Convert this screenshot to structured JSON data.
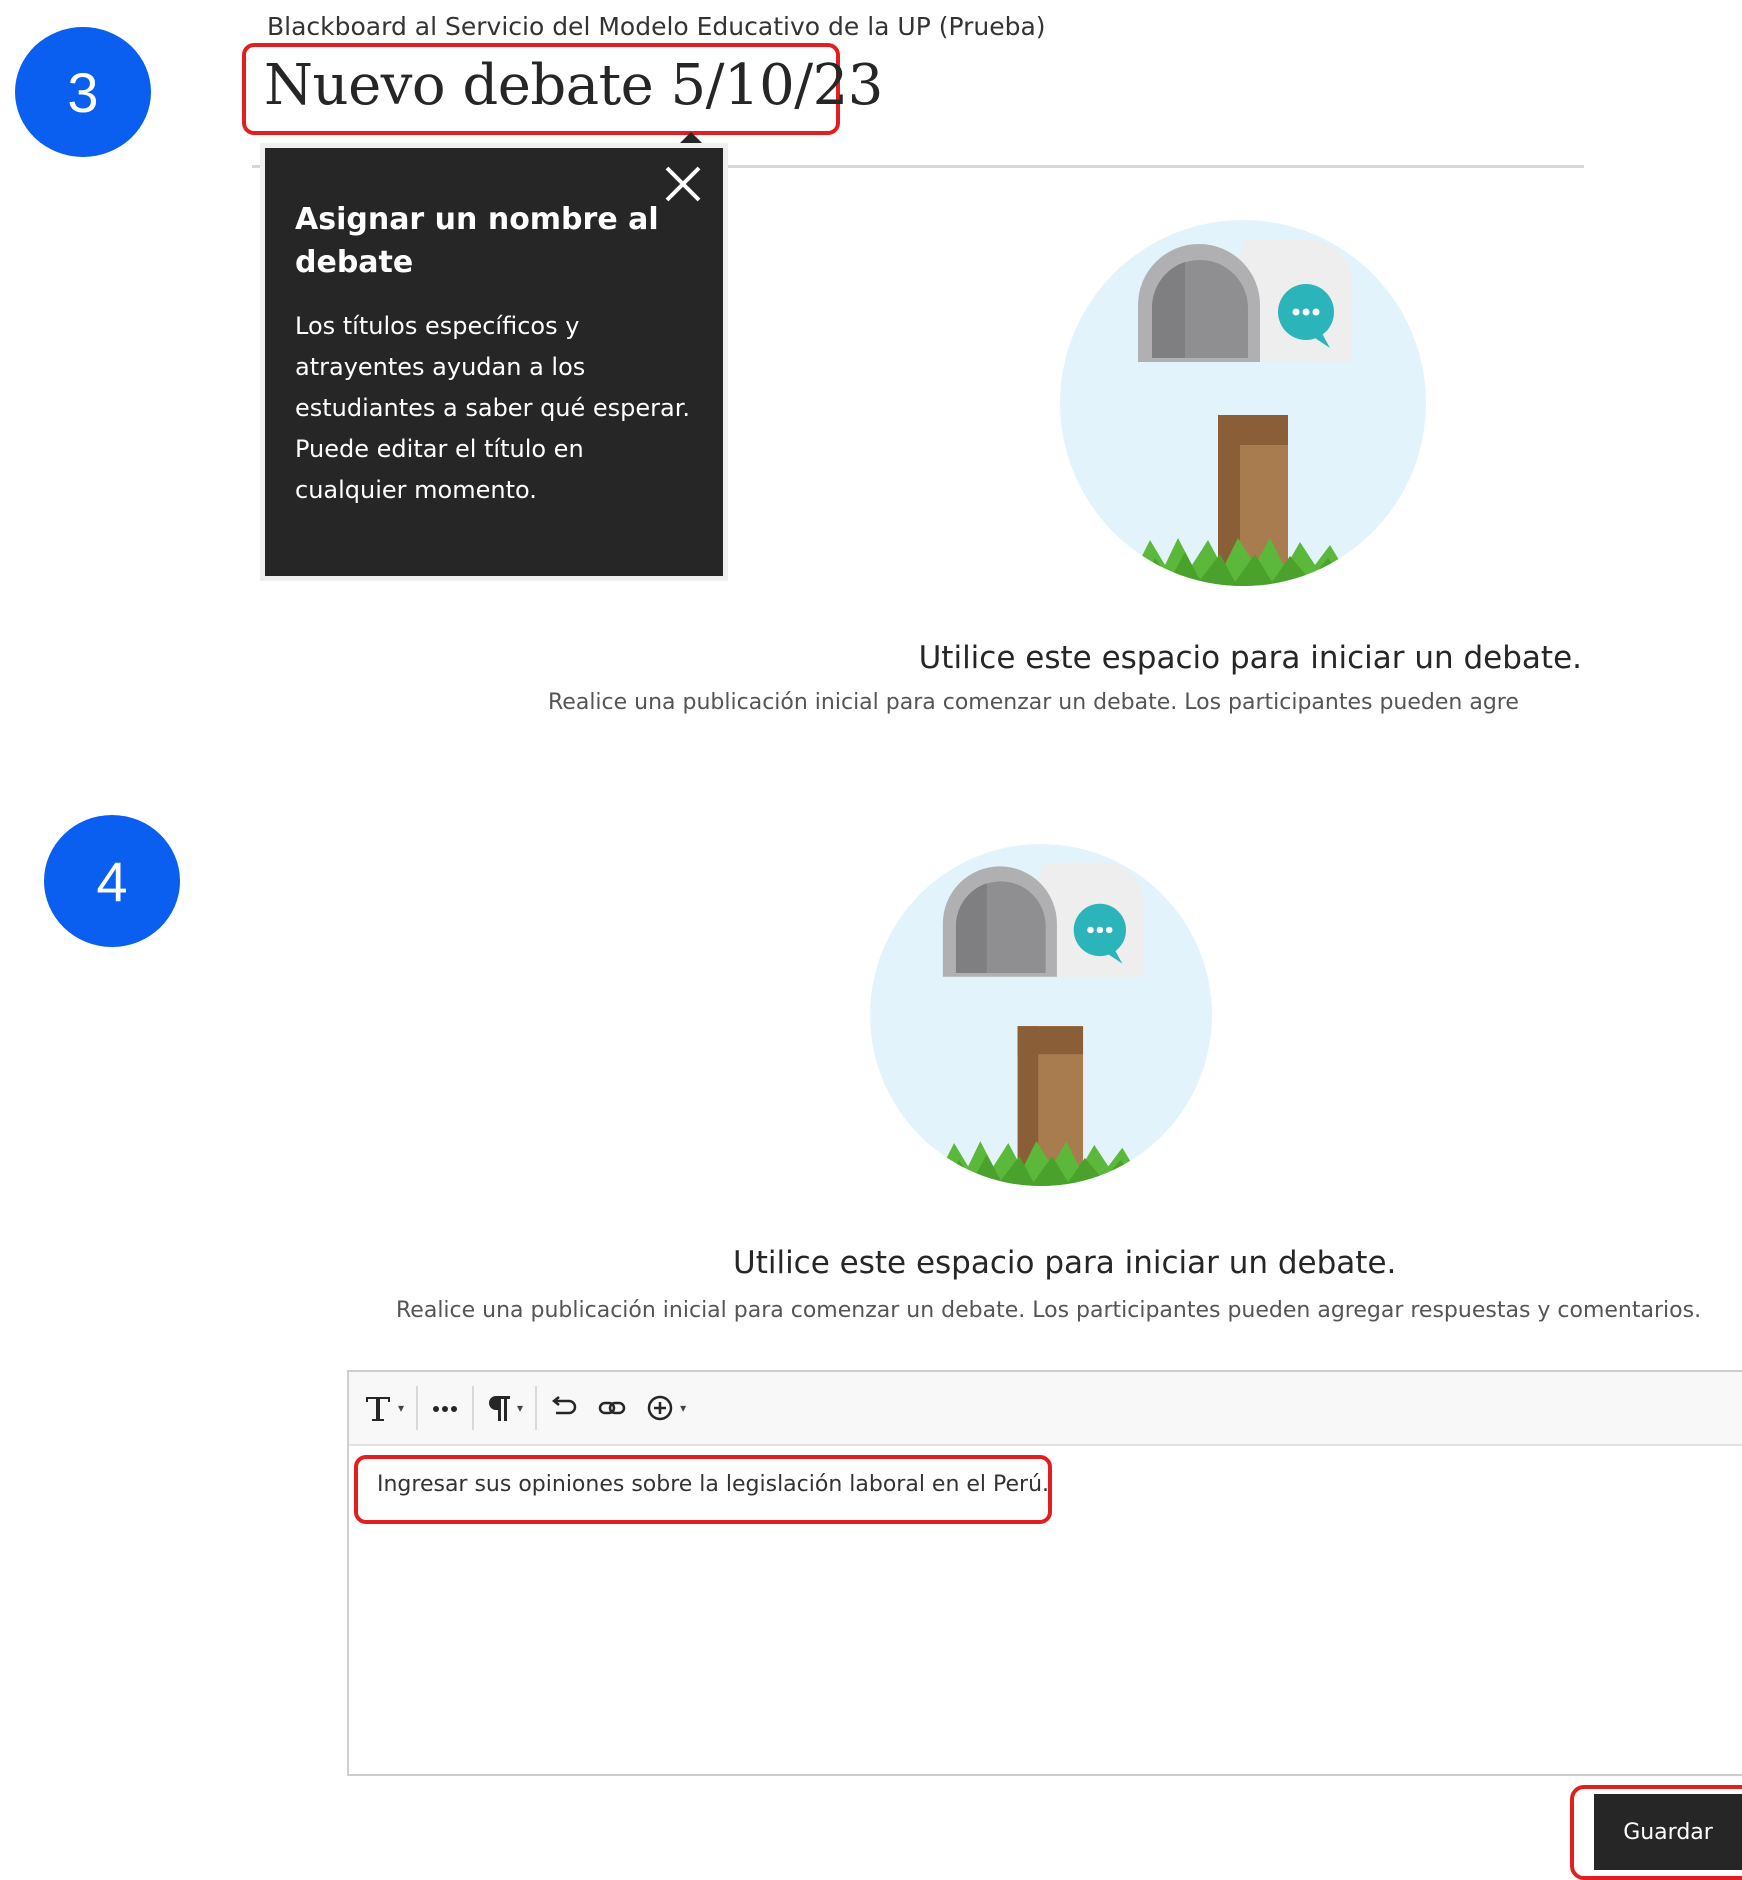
{
  "steps": {
    "step3": "3",
    "step4": "4"
  },
  "header": {
    "course_name": "Blackboard al Servicio del Modelo Educativo de la UP (Prueba)",
    "title": "Nuevo debate 5/10/23"
  },
  "tooltip": {
    "title": "Asignar un nombre al debate",
    "text": "Los títulos específicos y atrayentes ayudan a los estudiantes a saber qué esperar. Puede editar el título en cualquier momento.",
    "close_icon": "close-icon"
  },
  "empty_state_1": {
    "heading": "Utilice este espacio para iniciar un debate.",
    "subtext": "Realice una publicación inicial para comenzar un debate. Los participantes pueden agre"
  },
  "empty_state_2": {
    "heading": "Utilice este espacio para iniciar un debate.",
    "subtext": "Realice una publicación inicial para comenzar un debate. Los participantes pueden agregar respuestas y comentarios."
  },
  "editor": {
    "toolbar_icons": [
      "text-format-icon",
      "more-icon",
      "paragraph-icon",
      "undo-icon",
      "link-icon",
      "insert-plus-icon"
    ],
    "content": "Ingresar sus opiniones sobre la legislación laboral en el Perú."
  },
  "actions": {
    "save_label": "Guardar"
  },
  "colors": {
    "step_badge": "#0a5ff0",
    "highlight": "#e41e1e",
    "tooltip_bg": "#262626",
    "save_button_bg": "#262626",
    "illustration_circle": "#e3f3fb"
  }
}
